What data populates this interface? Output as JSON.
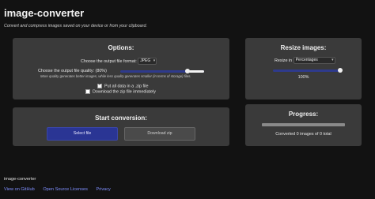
{
  "app": {
    "title": "image-converter",
    "subtitle": "Convert and compress images saved on your device or from your clipboard."
  },
  "options": {
    "title": "Options:",
    "format_label": "Choose the output file format:",
    "format_value": "JPEG",
    "quality_label": "Choose the output file quality: (80%)",
    "quality_value": 0.8,
    "quality_hint": "More quality generates better images, while less quality generates smaller (in terms of storage) files.",
    "zip_label": "Put all data in a .zip file",
    "zip_checked": true,
    "download_zip_label": "Download the zip file immediately",
    "download_zip_checked": false
  },
  "start": {
    "title": "Start conversion:",
    "select_label": "Select file",
    "download_label": "Download zip"
  },
  "resize": {
    "title": "Resize images:",
    "resize_in_label": "Resize in",
    "unit_value": "Percentages",
    "percent_value": 1.0,
    "percent_label": "100%"
  },
  "progress": {
    "title": "Progress:",
    "fraction": 0,
    "status": "Converted 0 images of 0 total"
  },
  "footer": {
    "name": "image-converter",
    "links": [
      "View on GitHub",
      "Open Source Licenses",
      "Privacy"
    ]
  },
  "colors": {
    "accent": "#2a3594",
    "background": "#121212",
    "card": "#3a3a3a",
    "link": "#7f8fff"
  }
}
